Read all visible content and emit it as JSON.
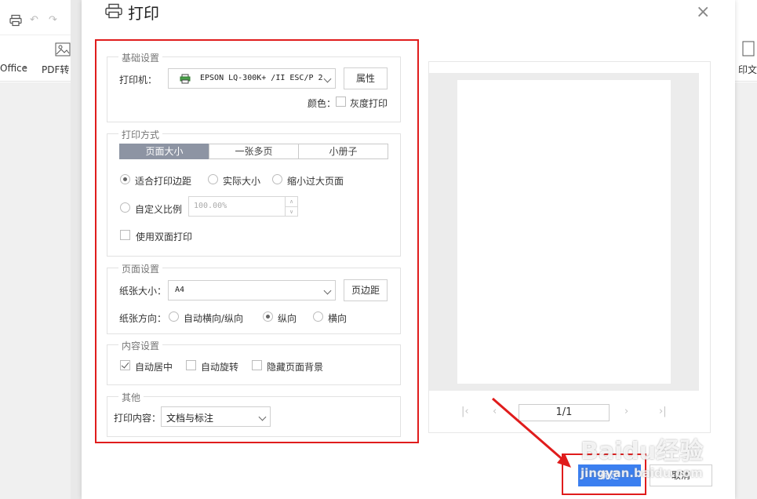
{
  "background": {
    "left_tool_office": "Office",
    "left_tool_pdf": "PDF转",
    "right_tool": "印文"
  },
  "dialog": {
    "title": "打印",
    "close_glyph": "×"
  },
  "basic": {
    "legend": "基础设置",
    "printer_label": "打印机：",
    "printer_value": "EPSON LQ-300K+ /II ESC/P 2",
    "properties_button": "属性",
    "color_label": "颜色：",
    "grayscale_label": "灰度打印",
    "grayscale_checked": false
  },
  "mode": {
    "legend": "打印方式",
    "tabs": [
      "页面大小",
      "一张多页",
      "小册子"
    ],
    "active_tab": 0,
    "fit_margin": "适合打印边距",
    "actual_size": "实际大小",
    "shrink_large": "缩小过大页面",
    "custom_scale": "自定义比例",
    "scale_value": "100.00%",
    "duplex": "使用双面打印",
    "selected_option": "fit_margin"
  },
  "page_setup": {
    "legend": "页面设置",
    "paper_size_label": "纸张大小：",
    "paper_size_value": "A4",
    "margins_button": "页边距",
    "orientation_label": "纸张方向：",
    "orient_auto": "自动横向/纵向",
    "orient_portrait": "纵向",
    "orient_landscape": "横向",
    "selected_orientation": "portrait"
  },
  "content": {
    "legend": "内容设置",
    "auto_center": "自动居中",
    "auto_rotate": "自动旋转",
    "hide_background": "隐藏页面背景",
    "auto_center_checked": true
  },
  "other": {
    "legend": "其他",
    "print_content_label": "打印内容：",
    "print_content_value": "文档与标注"
  },
  "preview": {
    "page_indicator": "1/1"
  },
  "footer": {
    "ok_button": "确定",
    "cancel_button": "取消"
  },
  "watermark": {
    "brand": "Baidu经验",
    "url": "jingyan.baidu.com"
  },
  "colors": {
    "accent": "#3b7ff0",
    "annotation_red": "#e01c1c",
    "active_tab": "#8d94a3"
  }
}
